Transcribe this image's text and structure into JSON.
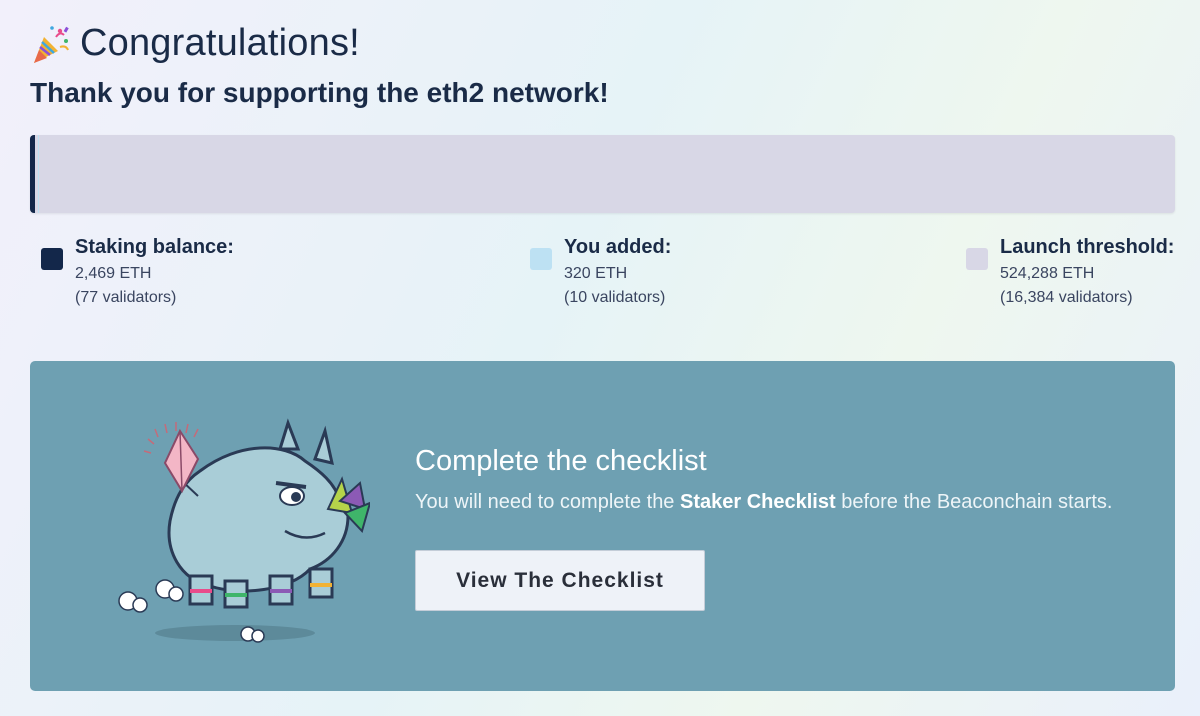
{
  "header": {
    "title": "Congratulations!",
    "subtitle": "Thank you for supporting the eth2 network!",
    "icon": "party-popper-icon"
  },
  "progress": {
    "staked_fraction": 0.0047,
    "added_fraction": 0.0006,
    "colors": {
      "staked": "#13274a",
      "added": "#bde1f3",
      "track": "#d8d7e6"
    }
  },
  "legend": [
    {
      "label": "Staking balance:",
      "amount": "2,469 ETH",
      "validators": "(77 validators)",
      "color": "#13274a"
    },
    {
      "label": "You added:",
      "amount": "320 ETH",
      "validators": "(10 validators)",
      "color": "#bde1f3"
    },
    {
      "label": "Launch threshold:",
      "amount": "524,288 ETH",
      "validators": "(16,384 validators)",
      "color": "#d8d7e6"
    }
  ],
  "checklist": {
    "heading": "Complete the checklist",
    "text_before": "You will need to complete the ",
    "text_bold": "Staker Checklist",
    "text_after": " before the Beaconchain starts.",
    "button_label": "View The Checklist",
    "illustration": "rhino-illustration",
    "background": "#6ea0b2"
  }
}
